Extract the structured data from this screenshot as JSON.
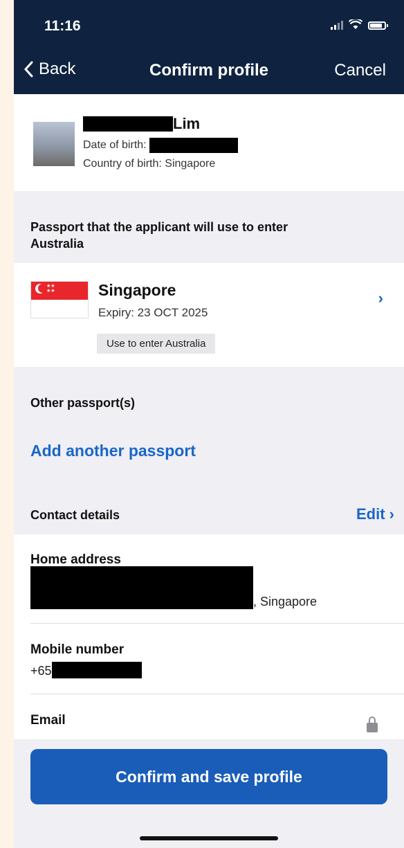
{
  "status_bar": {
    "time": "11:16"
  },
  "nav": {
    "back_label": "Back",
    "title": "Confirm profile",
    "cancel_label": "Cancel"
  },
  "profile": {
    "surname": "Lim",
    "dob_label": "Date of birth:",
    "country_of_birth": "Country of birth: Singapore"
  },
  "passport_section": {
    "heading": "Passport that the applicant will use to enter Australia",
    "country": "Singapore",
    "expiry": "Expiry: 23 OCT 2025",
    "badge": "Use to enter Australia"
  },
  "other_passports": {
    "heading": "Other passport(s)",
    "add_link": "Add another passport"
  },
  "contact": {
    "heading": "Contact details",
    "edit_label": "Edit",
    "home_address_label": "Home address",
    "home_address_suffix": ", Singapore",
    "mobile_label": "Mobile number",
    "mobile_prefix": "+65",
    "email_label": "Email"
  },
  "footer": {
    "confirm_label": "Confirm and save profile"
  },
  "colors": {
    "nav_bg": "#0f2341",
    "accent": "#1a66c8",
    "button": "#1a5db8"
  }
}
